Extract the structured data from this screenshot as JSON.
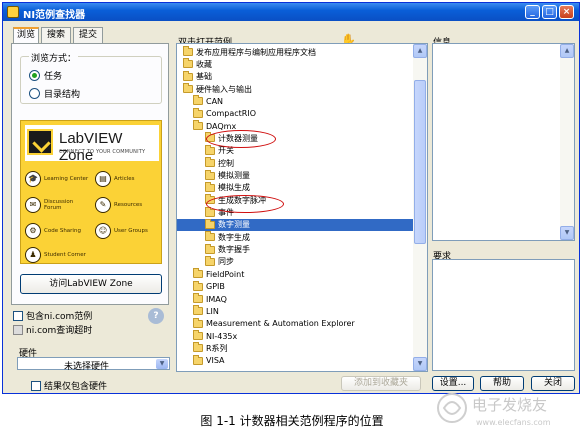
{
  "window": {
    "title": "NI范例查找器",
    "controls": [
      "_",
      "□",
      "×"
    ]
  },
  "tabs": [
    "浏览",
    "搜索",
    "提交"
  ],
  "browse": {
    "group_title": "浏览方式：",
    "options": [
      "任务",
      "目录结构"
    ],
    "selected": 0
  },
  "zone": {
    "name": "LabVIEW Zone",
    "tagline": "CONNECT TO YOUR COMMUNITY",
    "items": [
      {
        "label": "Learning Center",
        "icon": "graduation-icon"
      },
      {
        "label": "Articles",
        "icon": "document-icon"
      },
      {
        "label": "Discussion Forum",
        "icon": "chat-icon"
      },
      {
        "label": "Resources",
        "icon": "pencil-icon"
      },
      {
        "label": "Code Sharing",
        "icon": "gears-icon"
      },
      {
        "label": "User Groups",
        "icon": "group-icon"
      },
      {
        "label": "Student Corner",
        "icon": "student-icon"
      }
    ]
  },
  "visit_button": "访问LabVIEW Zone",
  "include_ni_com": "包含ni.com范例",
  "ni_timeout": "ni.com查询超时",
  "hardware": {
    "label": "硬件",
    "selected": "未选择硬件"
  },
  "results_only_hardware": "结果仅包含硬件",
  "tree": {
    "label": "双击打开范例。",
    "rows": [
      {
        "label": "发布应用程序与编制应用程序文档",
        "level": 0
      },
      {
        "label": "收藏",
        "level": 0
      },
      {
        "label": "基础",
        "level": 0
      },
      {
        "label": "硬件输入与输出",
        "level": 0
      },
      {
        "label": "CAN",
        "level": 1
      },
      {
        "label": "CompactRIO",
        "level": 1
      },
      {
        "label": "DAQmx",
        "level": 1
      },
      {
        "label": "计数器测量",
        "level": 2
      },
      {
        "label": "开关",
        "level": 2
      },
      {
        "label": "控制",
        "level": 2
      },
      {
        "label": "模拟测量",
        "level": 2
      },
      {
        "label": "模拟生成",
        "level": 2
      },
      {
        "label": "生成数字脉冲",
        "level": 2
      },
      {
        "label": "事件",
        "level": 2
      },
      {
        "label": "数字测量",
        "level": 2,
        "selected": true
      },
      {
        "label": "数字生成",
        "level": 2
      },
      {
        "label": "数字握手",
        "level": 2
      },
      {
        "label": "同步",
        "level": 2
      },
      {
        "label": "FieldPoint",
        "level": 1
      },
      {
        "label": "GPIB",
        "level": 1
      },
      {
        "label": "IMAQ",
        "level": 1
      },
      {
        "label": "LIN",
        "level": 1
      },
      {
        "label": "Measurement & Automation Explorer",
        "level": 1
      },
      {
        "label": "NI-435x",
        "level": 1
      },
      {
        "label": "R系列",
        "level": 1
      },
      {
        "label": "VISA",
        "level": 1
      }
    ],
    "highlighted": [
      "计数器测量",
      "生成数字脉冲"
    ]
  },
  "info_label": "信息",
  "requirements_label": "要求",
  "buttons": {
    "add_to_favorites": "添加到收藏夹",
    "settings": "设置...",
    "help": "帮助",
    "close": "关闭"
  },
  "caption": "图  1-1  计数器相关范例程序的位置",
  "watermark": {
    "cn": "电子发烧友",
    "url": "www.elecfans.com"
  }
}
